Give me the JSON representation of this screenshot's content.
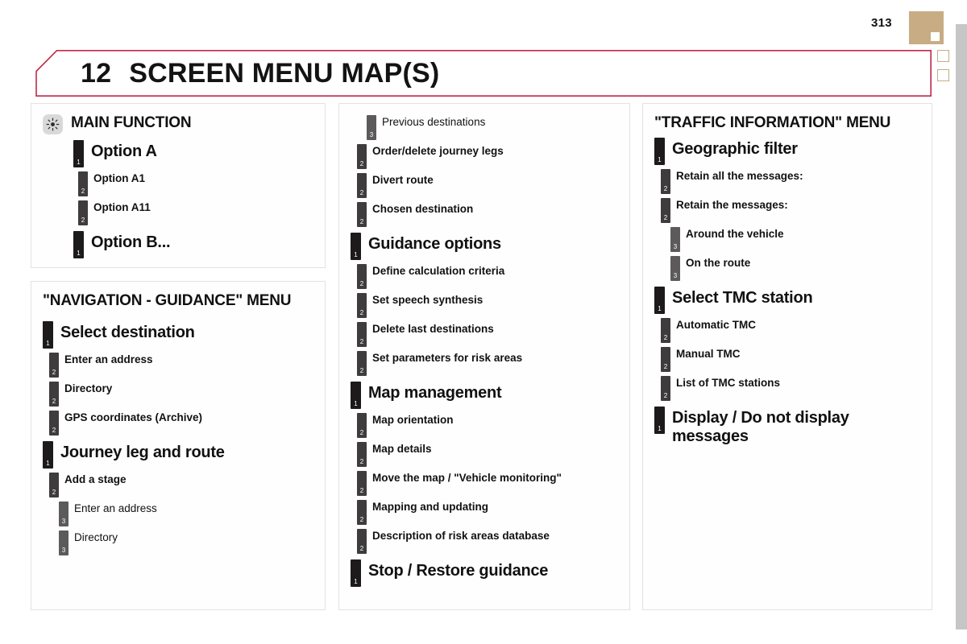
{
  "page": {
    "number": "313",
    "accent_color": "#c0294a",
    "tab_color": "#c7ac84",
    "edge_color": "#c6c6c6"
  },
  "header": {
    "chapter_number": "12",
    "title": "SCREEN MENU MAP(S)"
  },
  "columns": [
    {
      "name": "column-left",
      "cards": [
        {
          "name": "main-function-card",
          "icon": "sun-icon",
          "title": "MAIN FUNCTION",
          "items": [
            {
              "level": 1,
              "label": "Option A",
              "indent": "a"
            },
            {
              "level": 2,
              "label": "Option A1",
              "indent": "a"
            },
            {
              "level": 2,
              "label": "Option A11",
              "indent": "a"
            },
            {
              "level": 1,
              "label": "Option B...",
              "indent": "a"
            }
          ]
        },
        {
          "name": "navigation-guidance-card",
          "icon": null,
          "title": "\"NAVIGATION - GUIDANCE\" MENU",
          "items": [
            {
              "level": 1,
              "label": "Select destination"
            },
            {
              "level": 2,
              "label": "Enter an address"
            },
            {
              "level": 2,
              "label": "Directory"
            },
            {
              "level": 2,
              "label": "GPS coordinates (Archive)"
            },
            {
              "level": 1,
              "label": "Journey leg and route"
            },
            {
              "level": 2,
              "label": "Add a stage"
            },
            {
              "level": 3,
              "label": "Enter an address"
            },
            {
              "level": 3,
              "label": "Directory"
            }
          ]
        }
      ]
    },
    {
      "name": "column-middle",
      "cards": [
        {
          "name": "navigation-guidance-continued-card",
          "icon": null,
          "title": null,
          "items": [
            {
              "level": 3,
              "label": "Previous destinations"
            },
            {
              "level": 2,
              "label": "Order/delete journey legs"
            },
            {
              "level": 2,
              "label": "Divert route"
            },
            {
              "level": 2,
              "label": "Chosen destination"
            },
            {
              "level": 1,
              "label": "Guidance options"
            },
            {
              "level": 2,
              "label": "Define calculation criteria"
            },
            {
              "level": 2,
              "label": "Set speech synthesis"
            },
            {
              "level": 2,
              "label": "Delete last destinations"
            },
            {
              "level": 2,
              "label": "Set parameters for risk areas"
            },
            {
              "level": 1,
              "label": "Map management"
            },
            {
              "level": 2,
              "label": "Map orientation"
            },
            {
              "level": 2,
              "label": "Map details"
            },
            {
              "level": 2,
              "label": "Move the map / \"Vehicle monitoring\""
            },
            {
              "level": 2,
              "label": "Mapping and updating"
            },
            {
              "level": 2,
              "label": "Description of risk areas database"
            },
            {
              "level": 1,
              "label": "Stop / Restore guidance"
            }
          ]
        }
      ]
    },
    {
      "name": "column-right",
      "cards": [
        {
          "name": "traffic-information-card",
          "icon": null,
          "title": "\"TRAFFIC INFORMATION\" MENU",
          "items": [
            {
              "level": 1,
              "label": "Geographic filter"
            },
            {
              "level": 2,
              "label": "Retain all the messages:"
            },
            {
              "level": 2,
              "label": "Retain the messages:"
            },
            {
              "level": 3,
              "label": "Around the vehicle",
              "bold": true
            },
            {
              "level": 3,
              "label": "On the route",
              "bold": true
            },
            {
              "level": 1,
              "label": "Select TMC station"
            },
            {
              "level": 2,
              "label": "Automatic TMC"
            },
            {
              "level": 2,
              "label": "Manual TMC"
            },
            {
              "level": 2,
              "label": "List of TMC stations"
            },
            {
              "level": 1,
              "label": "Display / Do not display messages"
            }
          ]
        }
      ]
    }
  ],
  "level_markers": {
    "one": "1",
    "two": "2",
    "three": "3"
  }
}
